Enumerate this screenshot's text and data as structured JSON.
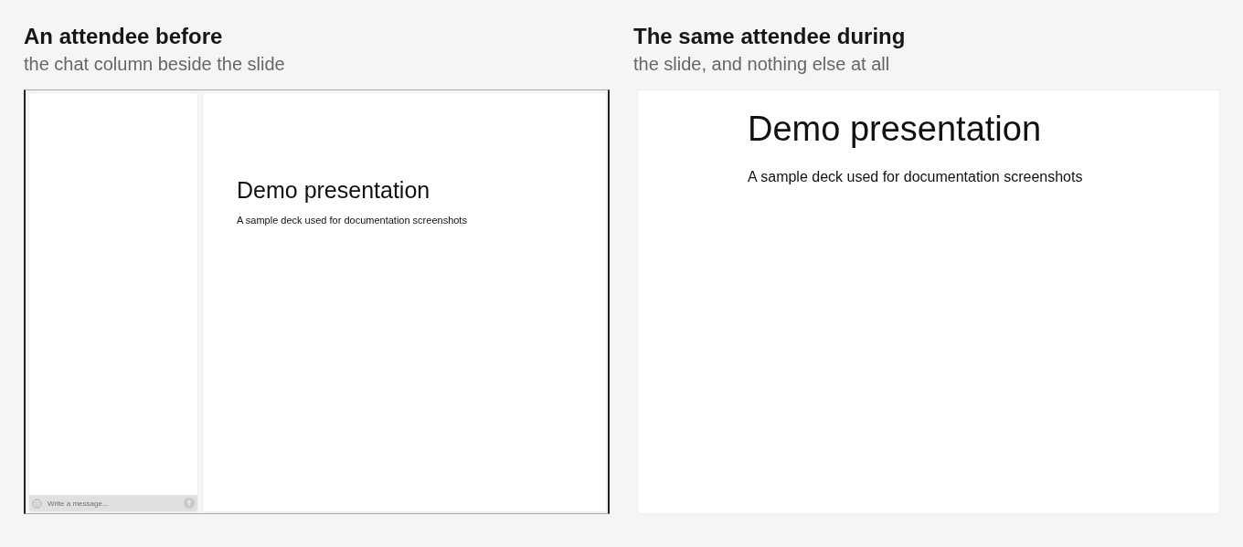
{
  "panels": [
    {
      "heading": "An attendee before",
      "caption": "the chat column beside the slide",
      "kind": "with_chat",
      "chat": {
        "placeholder": "Write a message..."
      },
      "slide": {
        "title": "Demo presentation",
        "subtitle": "A sample deck used for documentation screenshots"
      }
    },
    {
      "heading": "The same attendee during",
      "caption": "the slide, and nothing else at all",
      "kind": "slide_only",
      "slide": {
        "title": "Demo presentation",
        "subtitle": "A sample deck used for documentation screenshots"
      }
    }
  ]
}
